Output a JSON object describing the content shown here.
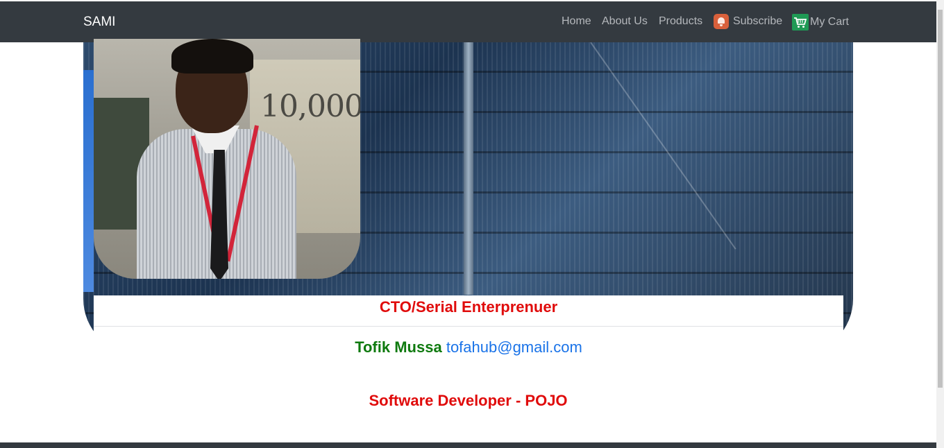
{
  "navbar": {
    "brand": "SAMI",
    "links": {
      "home": "Home",
      "about": "About Us",
      "products": "Products",
      "subscribe": "Subscribe",
      "cart": "My Cart"
    }
  },
  "hero": {
    "photo_banknote_text": "10,000"
  },
  "card": {
    "title": "CTO/Serial Enterprenuer",
    "name": "Tofik Mussa",
    "email": "tofahub@gmail.com"
  },
  "role": "Software Developer - POJO",
  "colors": {
    "navbar_bg": "#343a40",
    "title_red": "#e00b0b",
    "name_green": "#0f7a0f",
    "email_blue": "#1a73e8"
  }
}
